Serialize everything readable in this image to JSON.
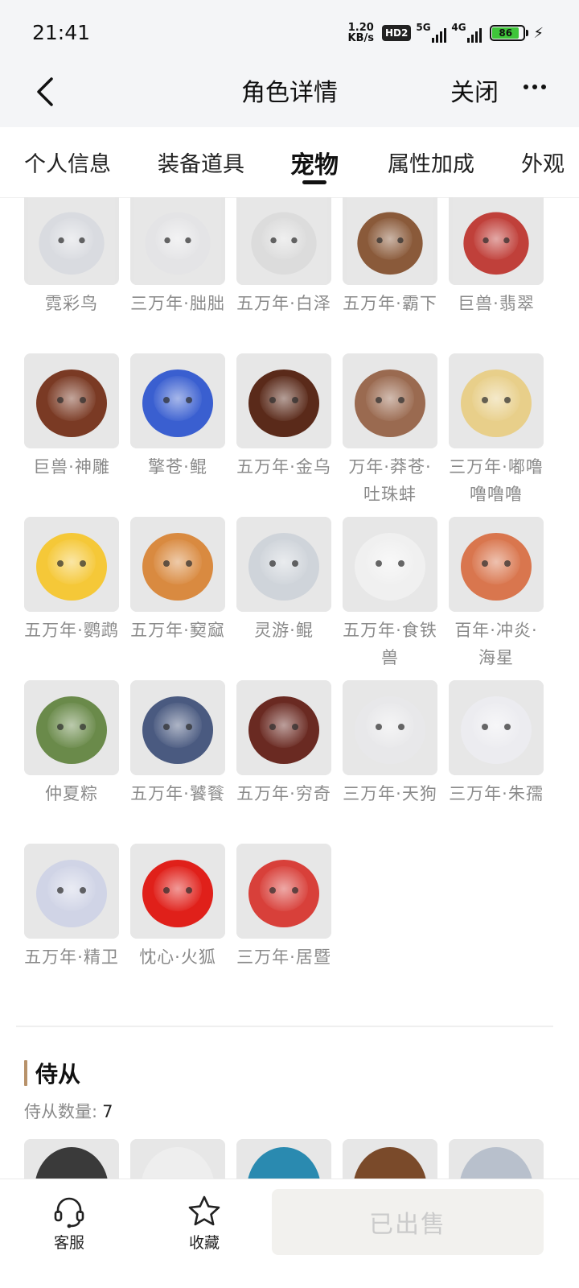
{
  "status_bar": {
    "time": "21:41",
    "net_speed_value": "1.20",
    "net_speed_unit": "KB/s",
    "hd_badge": "HD2",
    "sim1_label": "5G",
    "sim2_label": "4G",
    "battery_level": 86,
    "battery_text": "86"
  },
  "nav": {
    "title": "角色详情",
    "close_label": "关闭",
    "back_icon": "chevron-left-icon",
    "more_icon": "more-dots-icon"
  },
  "tabs": {
    "items": [
      {
        "label": "个人信息",
        "active": false
      },
      {
        "label": "装备道具",
        "active": false
      },
      {
        "label": "宠物",
        "active": true
      },
      {
        "label": "属性加成",
        "active": false
      },
      {
        "label": "外观",
        "active": false
      }
    ]
  },
  "pets": [
    {
      "name": "霓彩鸟",
      "icon": "white-fluffy-bird",
      "color": "#d9dbe0"
    },
    {
      "name": "三万年·朏朏",
      "icon": "white-cat",
      "color": "#e4e4e6"
    },
    {
      "name": "五万年·白泽",
      "icon": "white-beast",
      "color": "#dcdcdc"
    },
    {
      "name": "五万年·霸下",
      "icon": "dragon-head",
      "color": "#8a5a3a"
    },
    {
      "name": "巨兽·翡翠",
      "icon": "red-crest-lizard",
      "color": "#c0403a"
    },
    {
      "name": "巨兽·神雕",
      "icon": "eagle-head",
      "color": "#7a3a24"
    },
    {
      "name": "擎苍·鲲",
      "icon": "blue-whale-dragon",
      "color": "#3a5fd0"
    },
    {
      "name": "五万年·金乌",
      "icon": "black-gold-bird",
      "color": "#5a2a1a"
    },
    {
      "name": "万年·莽苍·吐珠蚌",
      "icon": "clam-creature",
      "color": "#9a6a50"
    },
    {
      "name": "三万年·嘟噜噜噜噜",
      "icon": "blonde-girl",
      "color": "#e8cf8a"
    },
    {
      "name": "五万年·鹦鹉",
      "icon": "yellow-parrot",
      "color": "#f5c838"
    },
    {
      "name": "五万年·窫窳",
      "icon": "orange-horned-girl",
      "color": "#d98a40"
    },
    {
      "name": "灵游·鲲",
      "icon": "white-fish-dragon",
      "color": "#cfd4da"
    },
    {
      "name": "五万年·食铁兽",
      "icon": "panda",
      "color": "#f0f0f0"
    },
    {
      "name": "百年·冲炎·海星",
      "icon": "starfish",
      "color": "#d9764e"
    },
    {
      "name": "仲夏粽",
      "icon": "zongzi",
      "color": "#6a8a4a"
    },
    {
      "name": "五万年·饕餮",
      "icon": "blue-armored-beast",
      "color": "#4a5a80"
    },
    {
      "name": "五万年·穷奇",
      "icon": "red-boar-beast",
      "color": "#6a2a22"
    },
    {
      "name": "三万年·天狗",
      "icon": "white-wolf",
      "color": "#e8e8ea"
    },
    {
      "name": "三万年·朱孺",
      "icon": "white-fox-red-mark",
      "color": "#ececf0"
    },
    {
      "name": "五万年·精卫",
      "icon": "pale-fairy-girl",
      "color": "#d0d4e6"
    },
    {
      "name": "忱心·火狐",
      "icon": "red-fire-fox",
      "color": "#e0201a"
    },
    {
      "name": "三万年·居暨",
      "icon": "red-hedgehog",
      "color": "#d8403a"
    }
  ],
  "servants": {
    "title": "侍从",
    "count_label": "侍从数量:",
    "count": "7",
    "previews": [
      {
        "icon": "black-white-beast",
        "color": "#3a3a3a"
      },
      {
        "icon": "white-haired-figure",
        "color": "#eeeeee"
      },
      {
        "icon": "blue-haired-figure",
        "color": "#2a8ab0"
      },
      {
        "icon": "brown-furred-figure",
        "color": "#7a4a2a"
      },
      {
        "icon": "silver-haired-figure",
        "color": "#b8c0cc"
      }
    ]
  },
  "bottom_bar": {
    "service_label": "客服",
    "service_icon": "headset-icon",
    "favorite_label": "收藏",
    "favorite_icon": "star-outline-icon",
    "sold_label": "已出售"
  }
}
